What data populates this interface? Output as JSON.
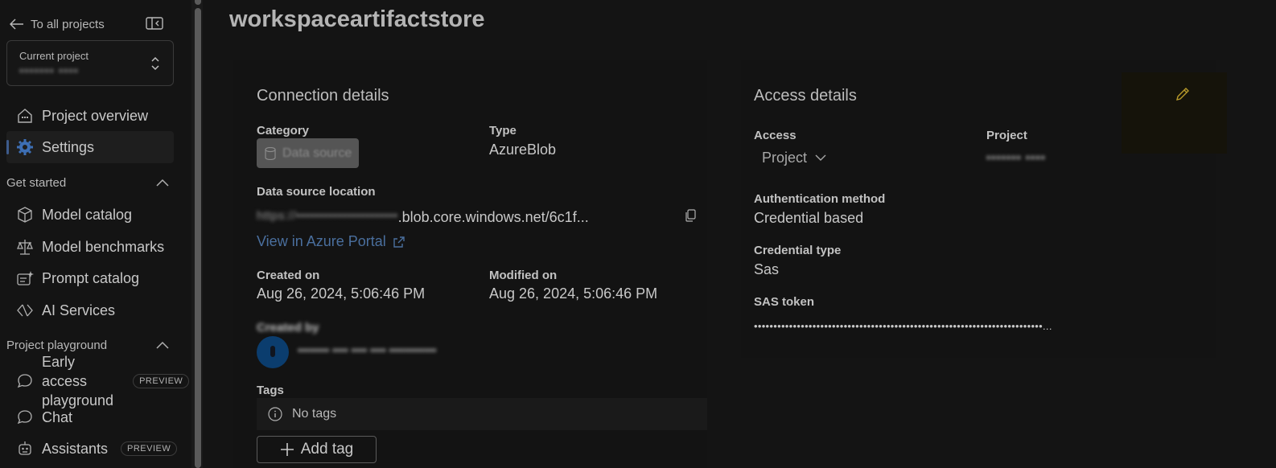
{
  "sidebar": {
    "back_label": "To all projects",
    "current_project_label": "Current project",
    "current_project_value": "••••••• ••••",
    "nav": [
      {
        "label": "Project overview",
        "icon": "home-icon"
      },
      {
        "label": "Settings",
        "icon": "gear-icon",
        "active": true
      }
    ],
    "get_started": {
      "label": "Get started",
      "items": [
        {
          "label": "Model catalog",
          "icon": "cube-icon"
        },
        {
          "label": "Model benchmarks",
          "icon": "scale-icon"
        },
        {
          "label": "Prompt catalog",
          "icon": "prompt-icon"
        },
        {
          "label": "AI Services",
          "icon": "ai-services-icon"
        }
      ]
    },
    "playground": {
      "label": "Project playground",
      "items": [
        {
          "label": "Early access",
          "label2": "playground",
          "badge": "PREVIEW",
          "icon": "chat-bubble-icon"
        },
        {
          "label": "Chat",
          "icon": "chat-icon"
        },
        {
          "label": "Assistants",
          "badge": "PREVIEW",
          "icon": "bot-icon"
        }
      ]
    }
  },
  "main": {
    "title": "workspaceartifactstore",
    "connection": {
      "title": "Connection details",
      "category_label": "Category",
      "category_value": "Data source",
      "type_label": "Type",
      "type_value": "AzureBlob",
      "location_label": "Data source location",
      "location_blurred": "https://••••••••••••••••••••••",
      "location_visible": ".blob.core.windows.net/6c1f...",
      "portal_link": "View in Azure Portal",
      "created_label": "Created on",
      "created_value": "Aug 26, 2024, 5:06:46 PM",
      "modified_label": "Modified on",
      "modified_value": "Aug 26, 2024, 5:06:46 PM",
      "created_by_label": "Created by",
      "created_by_value": "•••••••• •••• •••• •••• ••••••••••••",
      "tags_label": "Tags",
      "no_tags": "No tags",
      "add_tag": "Add tag"
    },
    "access": {
      "title": "Access details",
      "access_label": "Access",
      "access_value": "Project",
      "project_label": "Project",
      "project_value": "••••••• ••••",
      "auth_label": "Authentication method",
      "auth_value": "Credential based",
      "cred_type_label": "Credential type",
      "cred_type_value": "Sas",
      "sas_label": "SAS token",
      "sas_value": "••••••••••••••••••••••••••••••••••••••••••••••••••••••••••••••••••••••••••..."
    }
  },
  "colors": {
    "accent": "#3d5b8c",
    "link": "#4a6f9e",
    "edit_icon": "#b89a2a"
  }
}
